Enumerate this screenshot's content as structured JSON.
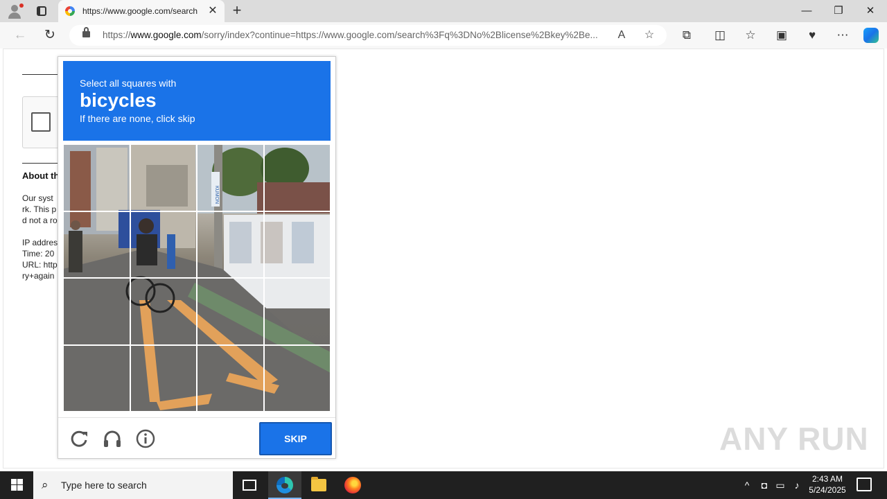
{
  "browser": {
    "tab_title": "https://www.google.com/search",
    "tab_close": "✕",
    "new_tab": "+",
    "url_prefix": "https://",
    "url_host": "www.google.com",
    "url_path": "/sorry/index?continue=https://www.google.com/search%3Fq%3DNo%2Blicense%2Bkey%2Be...",
    "window_controls": {
      "minimize": "—",
      "maximize": "❐",
      "close": "✕"
    }
  },
  "page": {
    "about_heading": "About th",
    "text_lines": [
      "Our syst",
      "rk. This p",
      "d not a ro",
      "",
      "IP addres",
      "Time: 20",
      "URL: http",
      "ry+again"
    ]
  },
  "captcha": {
    "instruction": "Select all squares with",
    "target": "bicycles",
    "hint": "If there are none, click skip",
    "skip_label": "SKIP",
    "grid_rows": 4,
    "grid_cols": 4,
    "sign_text": "KUMON"
  },
  "watermark": "ANY RUN",
  "taskbar": {
    "search_placeholder": "Type here to search",
    "time": "2:43 AM",
    "date": "5/24/2025"
  },
  "colors": {
    "captcha_blue": "#1a73e8",
    "taskbar": "#202020"
  }
}
